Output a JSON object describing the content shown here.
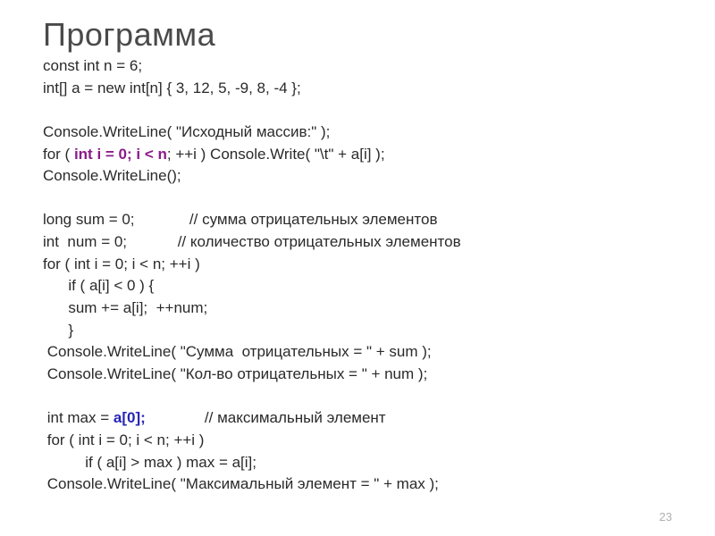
{
  "title": "Программа",
  "code": {
    "l1": "const int n = 6;",
    "l2": "int[] a = new int[n] { 3, 12, 5, -9, 8, -4 };",
    "l3": "",
    "l4": "Console.WriteLine( \"Исходный массив:\" );",
    "l5a": "for ( ",
    "l5b": "int i = 0; i < n",
    "l5c": "; ++i ) Console.Write( \"\\t\" + a[i] );",
    "l6": "Console.WriteLine();",
    "l7": "",
    "l8": "long sum = 0;             // сумма отрицательных элементов",
    "l9": "int  num = 0;            // количество отрицательных элементов",
    "l10": "for ( int i = 0; i < n; ++i )",
    "l11": "      if ( a[i] < 0 ) {",
    "l12": "      sum += a[i];  ++num;",
    "l13": "      }",
    "l14": " Console.WriteLine( \"Сумма  отрицательных = \" + sum );",
    "l15": " Console.WriteLine( \"Кол-во отрицательных = \" + num );",
    "l16": "",
    "l17a": " int max = ",
    "l17b": "a[0];",
    "l17c": "              // максимальный элемент",
    "l18": " for ( int i = 0; i < n; ++i )",
    "l19": "          if ( a[i] > max ) max = a[i];",
    "l20": " Console.WriteLine( \"Максимальный элемент = \" + max );"
  },
  "page_number": "23"
}
